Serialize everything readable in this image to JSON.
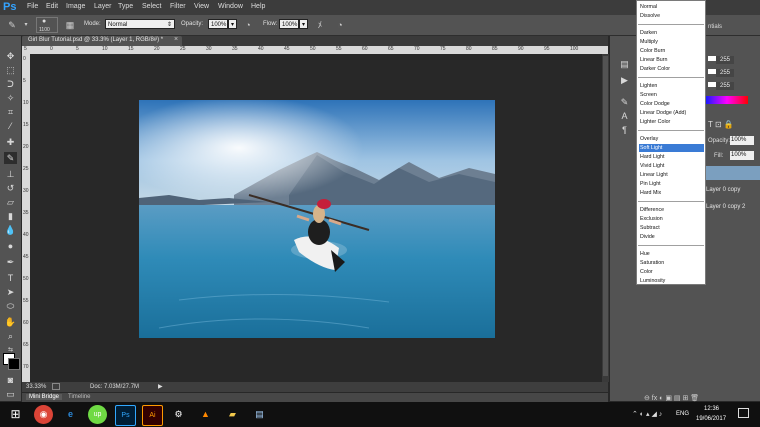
{
  "app": {
    "logo": "Ps"
  },
  "menu": [
    "File",
    "Edit",
    "Image",
    "Layer",
    "Type",
    "Select",
    "Filter",
    "View",
    "Window",
    "Help"
  ],
  "options_bar": {
    "brush_size": "1100",
    "mode_label": "Mode:",
    "mode_value": "Normal",
    "opacity_label": "Opacity:",
    "opacity_value": "100%",
    "flow_label": "Flow:",
    "flow_value": "100%"
  },
  "document_tab": {
    "title": "Girl Blur Tutorial.psd @ 33.3% (Layer 1, RGB/8#) *",
    "close": "×"
  },
  "ruler_top": [
    "5",
    "0",
    "5",
    "10",
    "15",
    "20",
    "25",
    "30",
    "35",
    "40",
    "45",
    "50",
    "55",
    "60",
    "65",
    "70",
    "75",
    "80",
    "85",
    "90",
    "95",
    "100"
  ],
  "ruler_left": [
    "0",
    "5",
    "10",
    "15",
    "20",
    "25",
    "30",
    "35",
    "40",
    "45",
    "50",
    "55",
    "60",
    "65",
    "70"
  ],
  "status_bar": {
    "zoom": "33.33%",
    "doc": "Doc: 7.03M/27.7M"
  },
  "bottom_tabs": [
    "Mini Bridge",
    "Timeline"
  ],
  "blend_modes": {
    "groups": [
      [
        "Normal",
        "Dissolve"
      ],
      [
        "Darken",
        "Multiply",
        "Color Burn",
        "Linear Burn",
        "Darker Color"
      ],
      [
        "Lighten",
        "Screen",
        "Color Dodge",
        "Linear Dodge (Add)",
        "Lighter Color"
      ],
      [
        "Overlay",
        "Soft Light",
        "Hard Light",
        "Vivid Light",
        "Linear Light",
        "Pin Light",
        "Hard Mix"
      ],
      [
        "Difference",
        "Exclusion",
        "Subtract",
        "Divide"
      ],
      [
        "Hue",
        "Saturation",
        "Color",
        "Luminosity"
      ]
    ],
    "selected": "Soft Light"
  },
  "right_panel": {
    "partial_heading": "ntials",
    "color_values": [
      "255",
      "255",
      "255"
    ],
    "opacity_label": "Opacity:",
    "opacity_value": "100%",
    "fill_label": "Fill:",
    "fill_value": "100%",
    "layers": [
      "Layer 0 copy",
      "Layer 0 copy 2"
    ]
  },
  "taskbar": {
    "language": "ENG",
    "time": "12:36",
    "date": "19/06/2017",
    "icons": [
      "windows-logo",
      "chrome",
      "edge",
      "upwork",
      "photoshop",
      "illustrator",
      "steam",
      "vlc",
      "file-explorer",
      "notepad"
    ]
  },
  "colors": {
    "accent": "#3a7bd5",
    "ps_blue": "#33a3ff",
    "panel": "#535353",
    "canvas_bg": "#282828"
  }
}
